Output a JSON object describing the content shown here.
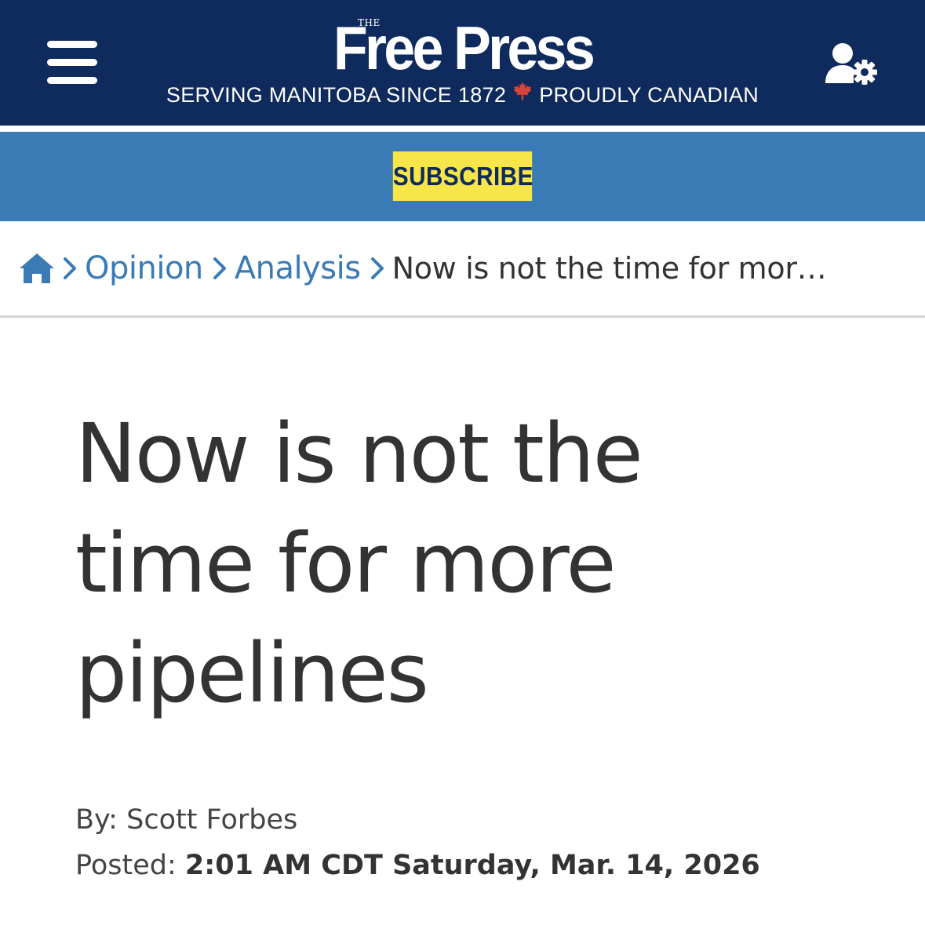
{
  "header": {
    "logo_small": "THE",
    "logo_name": "Free Press",
    "tagline_left": "SERVING MANITOBA SINCE 1872",
    "tagline_right": "PROUDLY CANADIAN",
    "menu_icon": "hamburger-menu-icon",
    "account_icon": "user-settings-icon",
    "flag_icon": "maple-leaf-icon"
  },
  "subscribe": {
    "label": "SUBSCRIBE"
  },
  "breadcrumb": {
    "home_icon": "home-icon",
    "items": [
      {
        "label": "Opinion"
      },
      {
        "label": "Analysis"
      }
    ],
    "current": "Now is not the time for mor…"
  },
  "article": {
    "headline": "Now is not the time for more pipelines",
    "byline_prefix": "By:",
    "author": "Scott Forbes",
    "posted_prefix": "Posted:",
    "posted_datetime": "2:01 AM CDT Saturday, Mar. 14, 2026"
  },
  "colors": {
    "header_bg": "#0f2a5c",
    "subbar_bg": "#3a7bb6",
    "subscribe_bg": "#f7e64a",
    "link": "#3a7bb6",
    "maple_leaf": "#d8433a",
    "text": "#333333"
  }
}
